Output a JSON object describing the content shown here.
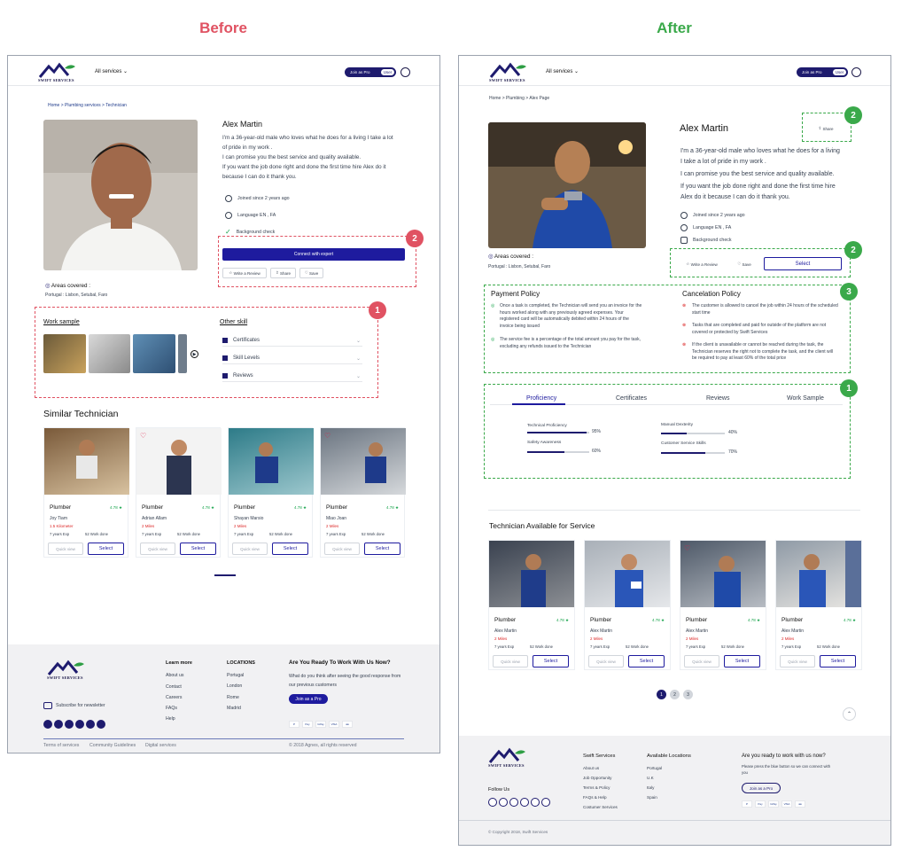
{
  "headings": {
    "before": "Before",
    "after": "After"
  },
  "colors": {
    "before": "#e05262",
    "after": "#3aa94a",
    "red_dash": "#e05262",
    "green_dash": "#3aa94a",
    "navy": "#1e1b6e"
  },
  "brand": "SWIFT SERVICES",
  "nav": {
    "services": "All services",
    "join": "Join as Pro",
    "user": "User"
  },
  "before": {
    "breadcrumb": [
      "Home",
      ">",
      "Plumbing services",
      ">",
      "Technician"
    ],
    "name": "Alex Martin",
    "bio": [
      "I'm a 36-year-old male who loves what he does for a living I take a lot",
      "of pride in my work .",
      "I can promise you the best service and quality available.",
      "If you want the job done right and done the first time hire Alex do it",
      "because I can do it thank you."
    ],
    "info": {
      "joined": "Joined since 2 years ago",
      "language": "Language EN , FA",
      "background": "Background check"
    },
    "connect": "Connect with expert",
    "review": "Write a Review",
    "share": "Share",
    "save": "Save",
    "areas": "Areas covered :",
    "areas_list": "Portugal : Lisbon, Setubal, Faro",
    "work_sample": "Work sample",
    "other_skill": "Other skill",
    "accordion": [
      "Certificates",
      "Skill Levels",
      "Reviews"
    ],
    "similar": "Similar Technician",
    "cards": [
      {
        "role": "Plumber",
        "rating": "4.78 ★",
        "name": "Joy Tiam",
        "dist": "1.5 Kilometer",
        "exp": "7 years Exp",
        "work": "52 Work done"
      },
      {
        "role": "Plumber",
        "rating": "4.78 ★",
        "name": "Adrian Allam",
        "dist": "2 Miles",
        "exp": "7 years Exp",
        "work": "52 Work done"
      },
      {
        "role": "Plumber",
        "rating": "4.78 ★",
        "name": "Shayan Marsio",
        "dist": "2 Miles",
        "exp": "7 years Exp",
        "work": "52 Work done"
      },
      {
        "role": "Plumber",
        "rating": "4.78 ★",
        "name": "Miao Joan",
        "dist": "2 Miles",
        "exp": "7 years Exp",
        "work": "52 Work done"
      }
    ],
    "quick_view": "Quick view",
    "select": "Select",
    "badges": [
      "2",
      "1"
    ],
    "footer": {
      "learn": "Learn more",
      "learn_items": [
        "About us",
        "Contact",
        "Careers",
        "FAQs",
        "Help"
      ],
      "locations": "LOCATIONS",
      "loc_items": [
        "Portugal",
        "London",
        "Rome",
        "Madrid"
      ],
      "cta_title": "Are You Ready To Work With Us Now?",
      "cta_text": [
        "What do you think after seeing the good response from",
        "our previous customers"
      ],
      "cta_btn": "Join as a Pro",
      "subscribe": "Subscribe for newsletter",
      "bottom": [
        "Terms of services",
        "Community Guidelines",
        "Digital services"
      ],
      "copyright": "© 2018 Agnes, all rights reserved"
    }
  },
  "after": {
    "breadcrumb": [
      "Home",
      ">",
      "Plumbing",
      ">",
      "Alex Page"
    ],
    "name": "Alex Martin",
    "share": "Share",
    "bio": [
      "I'm a 36-year-old male who loves what he does for a living",
      "I take a lot of pride in my work .",
      "I can promise you the best service and quality available.",
      "If you want the job done right and done the first time hire",
      "Alex do it because I can do it thank you."
    ],
    "info": {
      "joined": "Joined since 2 years ago",
      "language": "Language EN , FA",
      "background": "Background check"
    },
    "areas": "Areas covered :",
    "areas_list": "Portugal : Lisbon, Setubal, Faro",
    "review": "Write a Review",
    "save": "Save",
    "select": "Select",
    "payment": {
      "title": "Payment Policy",
      "items": [
        "Once a task is completed, the Technician will send you an invoice for the hours worked along with any previously agreed expenses. Your registered card will be automatically debited within 24 hours of the invoice being issued",
        "The service fee is a percentage of the total amount you pay for the task, excluding any refunds issued to the Technician"
      ]
    },
    "cancel": {
      "title": "Cancelation Policy",
      "items": [
        "The customer is allowed to cancel the job within 24 hours of the scheduled start time",
        "Tasks that are completed and paid for outside of the platform are not covered or protected by Swift Services",
        "If the client is unavailable or cannot be reached during the task, the Technician reserves the right not to complete the task, and the client will be required to pay at least 60% of the total price"
      ]
    },
    "tabs": [
      "Proficiency",
      "Certificates",
      "Reviews",
      "Work Sample"
    ],
    "skills": [
      {
        "label": "Technical Proficiency",
        "value": 95,
        "text": "95%"
      },
      {
        "label": "Safety Awareness",
        "value": 60,
        "text": "60%"
      },
      {
        "label": "Manual Dexterity",
        "value": 40,
        "text": "40%"
      },
      {
        "label": "Customer Service Skills",
        "value": 70,
        "text": "70%"
      }
    ],
    "available": "Technician Available for Service",
    "cards": [
      {
        "role": "Plumber",
        "rating": "4.78 ★",
        "name": "Alex Martin",
        "dist": "2 Miles",
        "exp": "7 years Exp",
        "work": "52 Work done"
      },
      {
        "role": "Plumber",
        "rating": "4.78 ★",
        "name": "Alex Martin",
        "dist": "2 Miles",
        "exp": "7 years Exp",
        "work": "52 Work done"
      },
      {
        "role": "Plumber",
        "rating": "4.78 ★",
        "name": "Alex Martin",
        "dist": "2 Miles",
        "exp": "7 years Exp",
        "work": "52 Work done"
      },
      {
        "role": "Plumber",
        "rating": "4.78 ★",
        "name": "Alex Martin",
        "dist": "2 Miles",
        "exp": "7 years Exp",
        "work": "52 Work done"
      }
    ],
    "quick_view": "Quick view",
    "pages": [
      "1",
      "2",
      "3"
    ],
    "badges": [
      "2",
      "2",
      "3",
      "1"
    ],
    "footer": {
      "follow": "Follow Us",
      "swift": "Swift Services",
      "swift_items": [
        "About us",
        "Job Opportunity",
        "Terms & Policy",
        "FAQs & Help",
        "Costumer Services"
      ],
      "locations": "Available Locations",
      "loc_items": [
        "Portugal",
        "U.K",
        "Italy",
        "Spain"
      ],
      "cta_title": "Are you ready to work with us now?",
      "cta_text": [
        "Please press the blue button so we can connect with",
        "you"
      ],
      "cta_btn": "Join as a Pro",
      "copyright": "© Copyright 2018, Swift Services"
    }
  },
  "payments": [
    "P",
    "Pay",
    "GPay",
    "VISA",
    "●●"
  ]
}
